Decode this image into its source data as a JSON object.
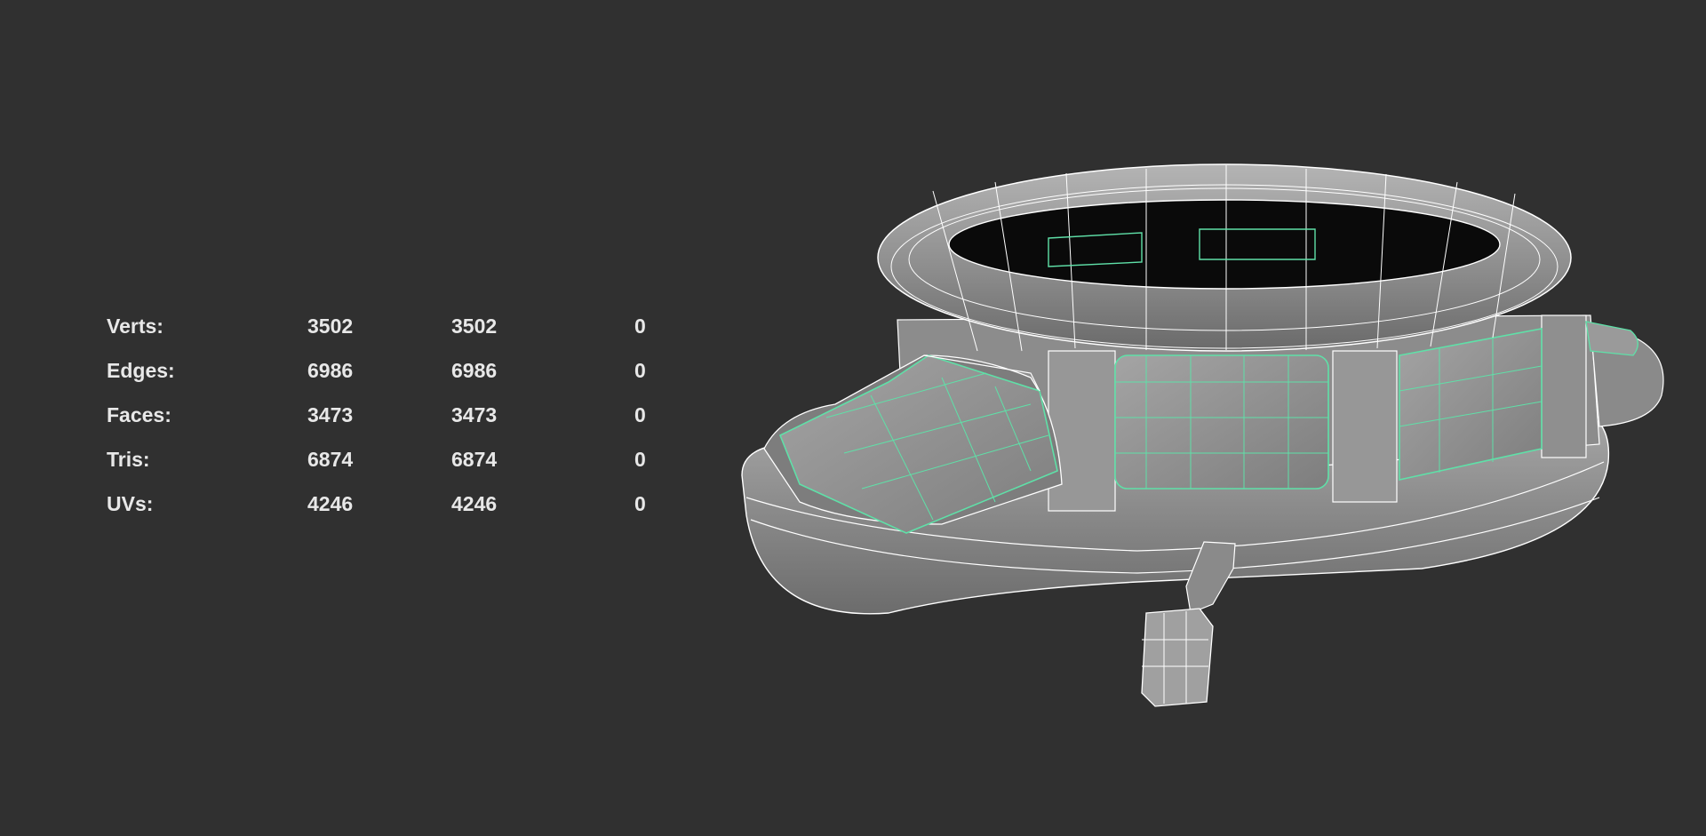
{
  "hud": {
    "rows": [
      {
        "label": "Verts:",
        "a": "3502",
        "b": "3502",
        "c": "0"
      },
      {
        "label": "Edges:",
        "a": "6986",
        "b": "6986",
        "c": "0"
      },
      {
        "label": "Faces:",
        "a": "3473",
        "b": "3473",
        "c": "0"
      },
      {
        "label": "Tris:",
        "a": "6874",
        "b": "6874",
        "c": "0"
      },
      {
        "label": "UVs:",
        "a": "4246",
        "b": "4246",
        "c": "0"
      }
    ]
  },
  "colors": {
    "background": "#303030",
    "text": "#e8e8e8",
    "wire": "#ffffff",
    "selected_wire": "#5fe0a8",
    "shade": "#9a9a9a"
  }
}
